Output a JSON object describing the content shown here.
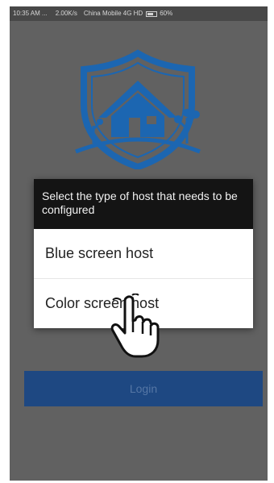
{
  "status_bar": {
    "time": "10:35 AM ...",
    "speed": "2.00K/s",
    "carrier": "China Mobile 4G HD",
    "battery": "60%"
  },
  "icons": {
    "logo": "shield-house-icon",
    "hand": "tap-hand-icon"
  },
  "login": {
    "label": "Login"
  },
  "dialog": {
    "title": "Select the type of host that needs to be configured",
    "options": [
      "Blue screen host",
      "Color screen host"
    ]
  },
  "colors": {
    "accent": "#214f8e",
    "logo_blue": "#1f6fc0",
    "dialog_header": "#141414",
    "background": "#6a6a6a"
  }
}
